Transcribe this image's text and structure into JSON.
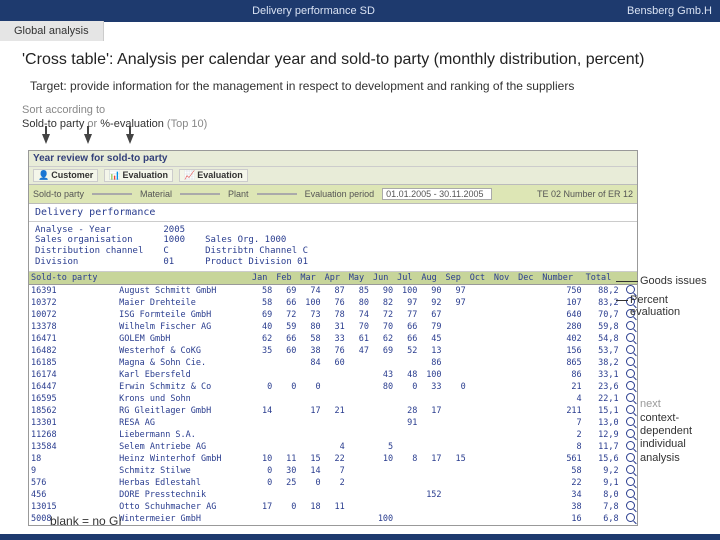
{
  "topbar": {
    "center": "Delivery performance SD",
    "right": "Bensberg Gmb.H"
  },
  "tab": "Global analysis",
  "title": "'Cross table': Analysis per calendar year and sold-to party (monthly distribution, percent)",
  "target": "Target: provide information for the management in respect to development and ranking of the suppliers",
  "sort": {
    "line1a": "Sort according to",
    "line2a": "Sold-to party",
    "line2b": " or ",
    "line2c": "%-evaluation",
    "line2d": " (Top 10)"
  },
  "sap": {
    "title": "Year review for sold-to party",
    "tool1": "Customer",
    "tool2": "Evaluation",
    "tool3": "Evaluation",
    "filter": {
      "l1": "Sold-to party",
      "l2": "Material",
      "l3": "Plant",
      "periodLabel": "Evaluation period",
      "periodVal": "01.01.2005 - 30.11.2005",
      "rightVal": "TE 02  Number of ER 12"
    },
    "section": "Delivery performance",
    "meta1a": "Analyse - Year",
    "meta1b": "2005",
    "meta2a": "Sales organisation",
    "meta2b": "1000",
    "meta2c": "Sales Org. 1000",
    "meta3a": "Distribution channel",
    "meta3b": "C",
    "meta3c": "Distribtn Channel C",
    "meta4a": "Division",
    "meta4b": "01",
    "meta4c": "Product Division 01"
  },
  "cols": [
    "Sold-to party",
    "",
    "Jan",
    "Feb",
    "Mar",
    "Apr",
    "May",
    "Jun",
    "Jul",
    "Aug",
    "Sep",
    "Oct",
    "Nov",
    "Dec",
    "Number",
    "Total"
  ],
  "rows": [
    [
      "16391",
      "August Schmitt GmbH",
      "58",
      "69",
      "74",
      "87",
      "85",
      "90",
      "100",
      "90",
      "97",
      "",
      "",
      "",
      "750",
      "88,2"
    ],
    [
      "10372",
      "Maier Drehteile",
      "58",
      "66",
      "100",
      "76",
      "80",
      "82",
      "97",
      "92",
      "97",
      "",
      "",
      "",
      "107",
      "83,2"
    ],
    [
      "10072",
      "ISG Formteile GmbH",
      "69",
      "72",
      "73",
      "78",
      "74",
      "72",
      "77",
      "67",
      "",
      "",
      "",
      "",
      "640",
      "70,7"
    ],
    [
      "13378",
      "Wilhelm Fischer AG",
      "40",
      "59",
      "80",
      "31",
      "70",
      "70",
      "66",
      "79",
      "",
      "",
      "",
      "",
      "280",
      "59,8"
    ],
    [
      "16471",
      "GOLEM GmbH",
      "62",
      "66",
      "58",
      "33",
      "61",
      "62",
      "66",
      "45",
      "",
      "",
      "",
      "",
      "402",
      "54,8"
    ],
    [
      "16482",
      "Westerhof & CoKG",
      "35",
      "60",
      "38",
      "76",
      "47",
      "69",
      "52",
      "13",
      "",
      "",
      "",
      "",
      "156",
      "53,7"
    ],
    [
      "16185",
      "Magna & Sohn Cie.",
      "",
      "",
      "84",
      "60",
      "",
      "",
      "",
      "86",
      "",
      "",
      "",
      "",
      "865",
      "38,2"
    ],
    [
      "16174",
      "Karl Ebersfeld",
      "",
      "",
      "",
      "",
      "",
      "43",
      "48",
      "100",
      "",
      "",
      "",
      "",
      "86",
      "33,1"
    ],
    [
      "16447",
      "Erwin Schmitz & Co",
      "0",
      "0",
      "0",
      "",
      "",
      "80",
      "0",
      "33",
      "0",
      "",
      "",
      "",
      "21",
      "23,6"
    ],
    [
      "16595",
      "Krons und Sohn",
      "",
      "",
      "",
      "",
      "",
      "",
      "",
      "",
      "",
      "",
      "",
      "",
      "4",
      "22,1"
    ],
    [
      "18562",
      "RG Gleitlager GmbH",
      "14",
      "",
      "17",
      "21",
      "",
      "",
      "28",
      "17",
      "",
      "",
      "",
      "",
      "211",
      "15,1"
    ],
    [
      "13301",
      "RESA AG",
      "",
      "",
      "",
      "",
      "",
      "",
      "91",
      "",
      "",
      "",
      "",
      "",
      "7",
      "13,0"
    ],
    [
      "11268",
      "Liebermann S.A.",
      "",
      "",
      "",
      "",
      "",
      "",
      "",
      "",
      "",
      "",
      "",
      "",
      "2",
      "12,9"
    ],
    [
      "13584",
      "Selem Antriebe AG",
      "",
      "",
      "",
      "4",
      "",
      "5",
      "",
      "",
      "",
      "",
      "",
      "",
      "8",
      "11,7"
    ],
    [
      "18",
      "Heinz Winterhof GmbH",
      "10",
      "11",
      "15",
      "22",
      "",
      "10",
      "8",
      "17",
      "15",
      "",
      "",
      "",
      "561",
      "15,6"
    ],
    [
      "9",
      "Schmitz Stilwe",
      "0",
      "30",
      "14",
      "7",
      "",
      "",
      "",
      "",
      "",
      "",
      "",
      "",
      "58",
      "9,2"
    ],
    [
      "576",
      "Herbas Edlestahl",
      "0",
      "25",
      "0",
      "2",
      "",
      "",
      "",
      "",
      "",
      "",
      "",
      "",
      "22",
      "9,1"
    ],
    [
      "456",
      "DORE Presstechnik",
      "",
      "",
      "",
      "",
      "",
      "",
      "",
      "152",
      "",
      "",
      "",
      "",
      "34",
      "8,0"
    ],
    [
      "13015",
      "Otto Schuhmacher AG",
      "17",
      "0",
      "18",
      "11",
      "",
      "",
      "",
      "",
      "",
      "",
      "",
      "",
      "38",
      "7,8"
    ],
    [
      "5008",
      "Wintermeier GmbH",
      "",
      "",
      "",
      "",
      "",
      "100",
      "",
      "",
      "",
      "",
      "",
      "",
      "16",
      "6,8"
    ]
  ],
  "ann": {
    "goods": "Goods issues",
    "percent": "Percent evaluation",
    "next": "next",
    "ctx": "context-dependent individual analysis"
  },
  "footer": "blank = no GI"
}
